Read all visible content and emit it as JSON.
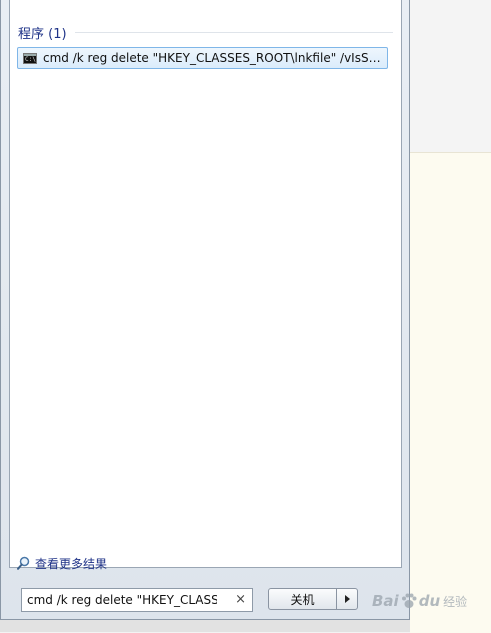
{
  "results": {
    "group_title": "程序 (1)",
    "items": [
      {
        "icon": "cmd-icon",
        "text": "cmd /k reg delete \"HKEY_CLASSES_ROOT\\lnkfile\" /vIsSho..."
      }
    ],
    "icon_glyph": "C:\\"
  },
  "see_more": {
    "label": "查看更多结果",
    "icon": "magnifier-icon"
  },
  "search": {
    "value": "cmd /k reg delete \"HKEY_CLASSES_ROOT\\lnkfile\" /v IsShortcut",
    "clear": "×"
  },
  "shutdown": {
    "label": "关机",
    "arrow_icon": "triangle-right-icon"
  },
  "watermark": {
    "logo": "Bai",
    "logo2": "du",
    "text": "经验"
  },
  "colors": {
    "accent_text": "#1e3287",
    "selection_border": "#7fb6e8"
  }
}
